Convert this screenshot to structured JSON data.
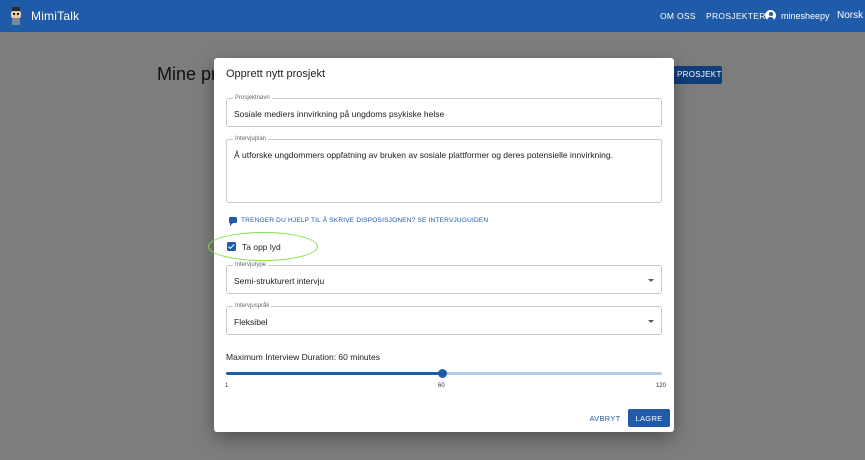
{
  "appbar": {
    "brand": "MimiTalk",
    "nav_about": "OM OSS",
    "nav_projects": "PROSJEKTER",
    "username": "minesheepy",
    "language": "Norsk",
    "logo_icon": "robot-logo-icon",
    "user_icon": "account-circle-icon",
    "color": "#1f5ba8"
  },
  "background": {
    "page_title": "Mine pr",
    "new_project_button": "PROSJEKT"
  },
  "dialog": {
    "title": "Opprett nytt prosjekt",
    "project_name": {
      "label": "Prosjektnavn",
      "value": "Sosiale mediers innvirkning på ungdoms psykiske helse"
    },
    "interview_plan": {
      "label": "Intervjuplan",
      "value": "Å utforske ungdommers oppfatning av bruken av sosiale plattformer og deres potensielle innvirkning."
    },
    "help_link": "TRENGER DU HJELP TIL Å SKRIVE DISPOSISJONEN? SE INTERVJUGUIDEN",
    "help_icon": "chat-icon",
    "record_audio": {
      "label": "Ta opp lyd",
      "checked": true
    },
    "interview_type": {
      "label": "Intervjutype",
      "value": "Semi-strukturert intervju"
    },
    "interview_language": {
      "label": "Intervjuspråk",
      "value": "Fleksibel"
    },
    "duration": {
      "label": "Maximum Interview Duration: 60 minutes",
      "min": 1,
      "max": 120,
      "value": 60,
      "min_label": "1",
      "value_label": "60",
      "max_label": "120"
    },
    "cancel_label": "AVBRYT",
    "save_label": "LAGRE"
  },
  "colors": {
    "accent": "#1f5ba8",
    "highlight": "#7fe04a"
  }
}
